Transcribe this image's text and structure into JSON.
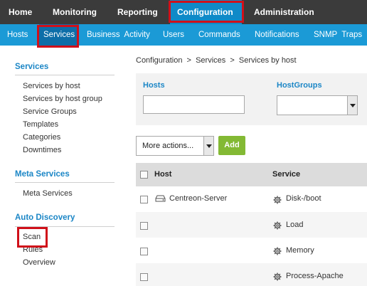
{
  "topnav": [
    {
      "label": "Home"
    },
    {
      "label": "Monitoring"
    },
    {
      "label": "Reporting"
    },
    {
      "label": "Configuration",
      "active": true
    },
    {
      "label": "Administration"
    }
  ],
  "subnav": [
    {
      "label": "Hosts"
    },
    {
      "label": "Services",
      "active": true
    },
    {
      "label": "Business  Activity"
    },
    {
      "label": "Users"
    },
    {
      "label": "Commands"
    },
    {
      "label": "Notifications"
    },
    {
      "label": "SNMP  Traps"
    }
  ],
  "sidebar": {
    "sections": [
      {
        "title": "Services",
        "items": [
          "Services by host",
          "Services by host group",
          "Service Groups",
          "Templates",
          "Categories",
          "Downtimes"
        ]
      },
      {
        "title": "Meta Services",
        "items": [
          "Meta Services"
        ]
      },
      {
        "title": "Auto Discovery",
        "items": [
          "Scan",
          "Rules",
          "Overview"
        ]
      }
    ]
  },
  "breadcrumb": "Configuration  >  Services  >  Services by host",
  "filters": {
    "hosts_label": "Hosts",
    "hosts_value": "",
    "hostgroups_label": "HostGroups",
    "hostgroups_value": ""
  },
  "actions": {
    "more_actions": "More actions...",
    "add": "Add"
  },
  "table": {
    "headers": {
      "host": "Host",
      "service": "Service"
    },
    "rows": [
      {
        "host": "Centreon-Server",
        "service": "Disk-/boot"
      },
      {
        "host": "",
        "service": "Load"
      },
      {
        "host": "",
        "service": "Memory"
      },
      {
        "host": "",
        "service": "Process-Apache"
      }
    ]
  },
  "colors": {
    "topbar": "#3b3b3b",
    "subbar": "#1b9ad6",
    "accent": "#1b86c6",
    "highlight_box": "#d0101a",
    "add_button": "#83b934"
  }
}
